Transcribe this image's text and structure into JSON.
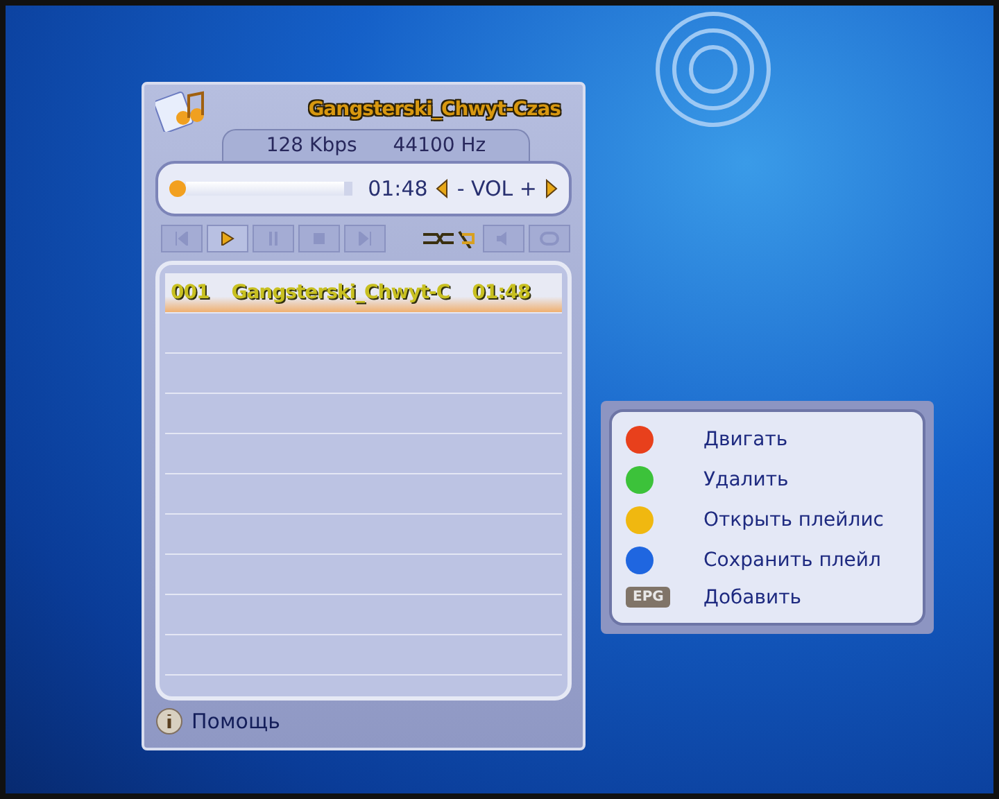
{
  "player": {
    "title": "Gangsterski_Chwyt-Czas",
    "bitrate": "128 Kbps",
    "samplerate": "44100 Hz",
    "progress": {
      "level": 0.95,
      "time": "01:48",
      "volume_label": "- VOL +"
    },
    "transport": [
      {
        "kind": "prev",
        "selected": false
      },
      {
        "kind": "play",
        "selected": true
      },
      {
        "kind": "pause",
        "selected": false
      },
      {
        "kind": "stop",
        "selected": false
      },
      {
        "kind": "next",
        "selected": false
      }
    ],
    "playlist": [
      {
        "number": "001",
        "name": "Gangsterski_Chwyt-C",
        "duration": "01:48",
        "selected": true
      }
    ],
    "help": "Помощь"
  },
  "legend": [
    {
      "kind": "dot",
      "color": "#e8401c",
      "label": "Двигать"
    },
    {
      "kind": "dot",
      "color": "#3cc23a",
      "label": "Удалить"
    },
    {
      "kind": "dot",
      "color": "#f0b810",
      "label": "Открыть плейлис"
    },
    {
      "kind": "dot",
      "color": "#1f66e0",
      "label": "Сохранить плейл"
    },
    {
      "kind": "key",
      "key": "EPG",
      "label": "Добавить"
    }
  ]
}
